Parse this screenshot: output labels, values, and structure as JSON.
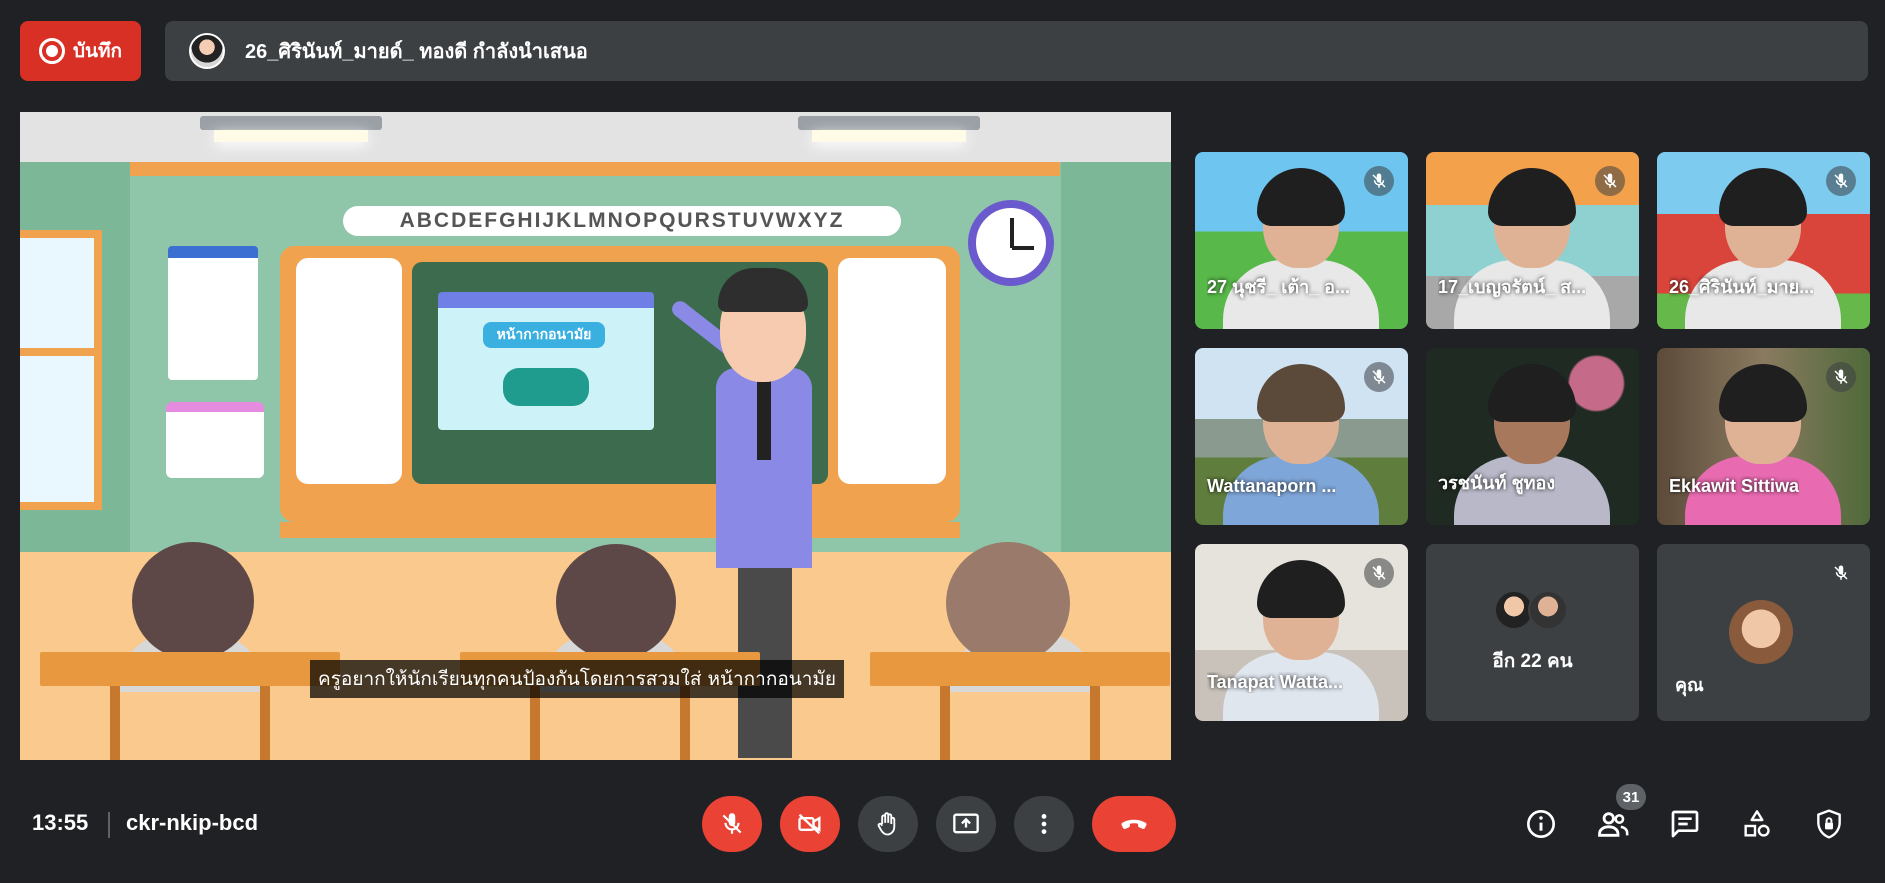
{
  "top_bar": {
    "record_label": "บันทึก",
    "presenting_text": "26_ศิรินันท์_มายด์_ ทองดี กำลังนำเสนอ"
  },
  "presentation": {
    "alphabet": "ABCDEFGHIJKLMNOPQURSTUVWXYZ",
    "poster_title": "หน้ากากอนามัย",
    "caption": "ครูอยากให้นักเรียนทุกคนป้องกันโดยการสวมใส่ หน้ากากอนามัย"
  },
  "tiles": [
    {
      "name": "27 นุชรี_ เต้า_ อ...",
      "muted": true
    },
    {
      "name": "17_เบญจรัตน์_ ส...",
      "muted": true
    },
    {
      "name": "26_ศิรินันท์_มาย...",
      "muted": true
    },
    {
      "name": "Wattanaporn ...",
      "muted": true
    },
    {
      "name": "วรชนันท์ ชูทอง",
      "muted": false
    },
    {
      "name": "Ekkawit Sittiwa",
      "muted": true
    },
    {
      "name": "Tanapat Watta...",
      "muted": true
    }
  ],
  "more_tile": {
    "label": "อีก 22 คน"
  },
  "self_tile": {
    "label": "คุณ",
    "muted": true
  },
  "bottom_bar": {
    "time": "13:55",
    "meeting_code": "ckr-nkip-bcd",
    "participant_count": "31"
  },
  "colors": {
    "background": "#202124",
    "danger": "#ea4335",
    "control_dark": "#3c4043"
  },
  "icons": {
    "mic": "mic-off-icon",
    "camera": "videocam-off-icon",
    "hand": "raise-hand-icon",
    "present": "present-screen-icon",
    "more": "more-vert-icon",
    "end": "call-end-icon",
    "info": "info-icon",
    "people": "people-icon",
    "chat": "chat-icon",
    "activities": "activities-icon",
    "host": "host-controls-icon"
  }
}
